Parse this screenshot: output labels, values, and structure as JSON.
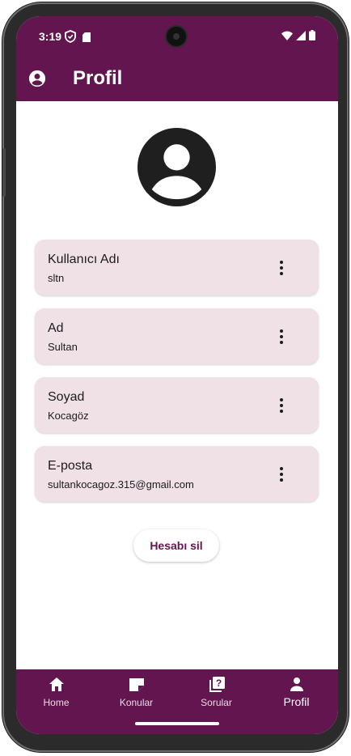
{
  "status_bar": {
    "time": "3:19",
    "icons": [
      "shield-icon",
      "sd-card-icon",
      "wifi-icon",
      "signal-icon",
      "battery-icon"
    ]
  },
  "app_bar": {
    "title": "Profil",
    "icon": "account-circle-icon"
  },
  "profile": {
    "avatar_icon": "account-circle-icon",
    "fields": [
      {
        "label": "Kullanıcı Adı",
        "value": "sltn"
      },
      {
        "label": "Ad",
        "value": "Sultan"
      },
      {
        "label": "Soyad",
        "value": "Kocagöz"
      },
      {
        "label": "E-posta",
        "value": "sultankocagoz.315@gmail.com"
      }
    ],
    "delete_button": "Hesabı sil"
  },
  "bottom_nav": {
    "items": [
      {
        "label": "Home",
        "icon": "home-icon",
        "active": false
      },
      {
        "label": "Konular",
        "icon": "label-icon",
        "active": false
      },
      {
        "label": "Sorular",
        "icon": "quiz-icon",
        "active": false
      },
      {
        "label": "Profil",
        "icon": "person-icon",
        "active": true
      }
    ]
  },
  "colors": {
    "primary": "#63154f",
    "card_background": "#efe1e6",
    "surface": "#ffffff"
  }
}
